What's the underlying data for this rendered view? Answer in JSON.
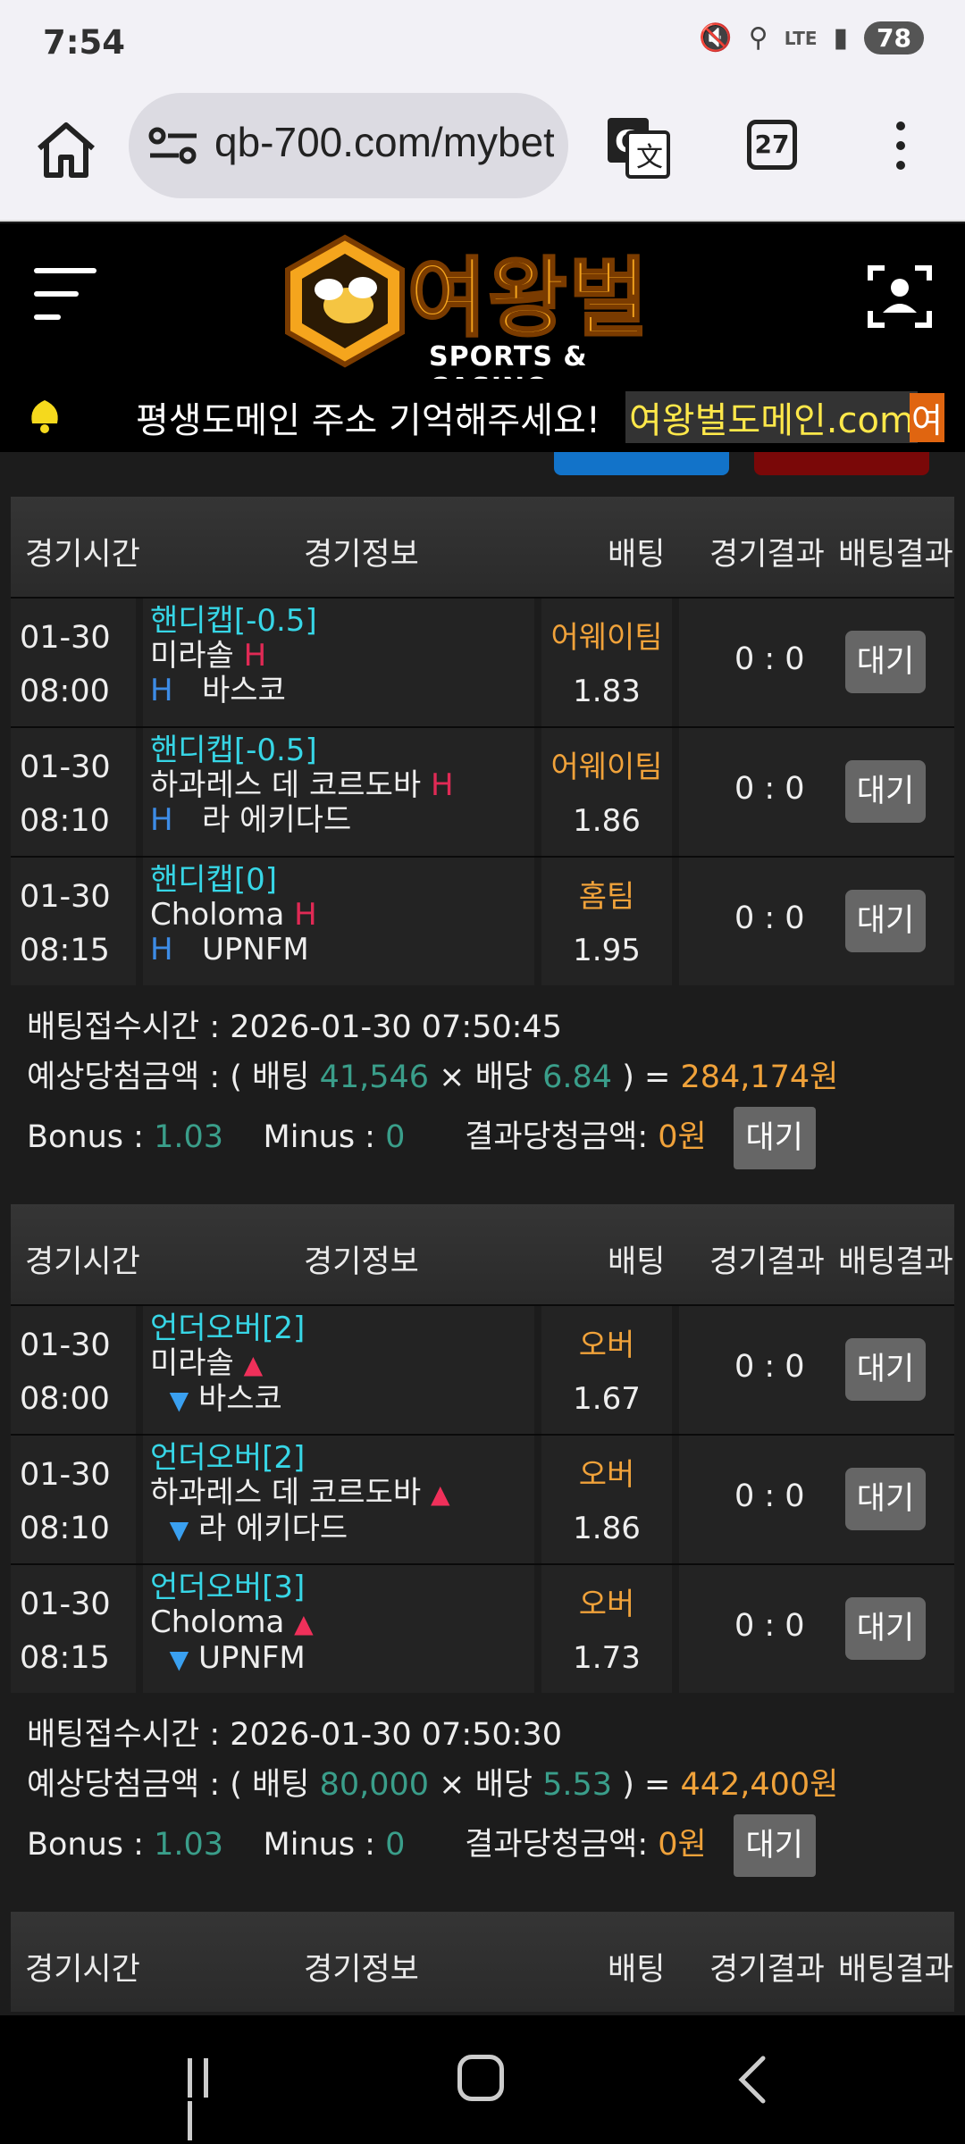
{
  "status_bar": {
    "time": "7:54",
    "network": "LTE",
    "battery": "78"
  },
  "browser": {
    "url": "qb-700.com/mybet",
    "tab_count": "27"
  },
  "site": {
    "logo_text": "여왕벌",
    "logo_sub": "SPORTS & CASINO"
  },
  "notice": {
    "text": "평생도메인 주소 기억해주세요!",
    "domain": "여왕벌도메인.com",
    "domain_tail": "여"
  },
  "table_headers": {
    "time": "경기시간",
    "info": "경기정보",
    "bet": "배팅",
    "result": "경기결과",
    "bet_result": "배팅결과"
  },
  "bets": [
    {
      "rows": [
        {
          "date": "01-30",
          "time": "08:00",
          "market": "핸디캡[-0.5]",
          "home": "미라솔",
          "home_mark": "H",
          "away_mark": "H",
          "away": "바스코",
          "pick": "어웨이팀",
          "odds": "1.83",
          "score": "0 : 0",
          "status": "대기"
        },
        {
          "date": "01-30",
          "time": "08:10",
          "market": "핸디캡[-0.5]",
          "home": "하과레스 데 코르도바",
          "home_mark": "H",
          "away_mark": "H",
          "away": "라 에키다드",
          "pick": "어웨이팀",
          "odds": "1.86",
          "score": "0 : 0",
          "status": "대기"
        },
        {
          "date": "01-30",
          "time": "08:15",
          "market": "핸디캡[0]",
          "home": "Choloma",
          "home_mark": "H",
          "away_mark": "H",
          "away": "UPNFM",
          "pick": "홈팀",
          "odds": "1.95",
          "score": "0 : 0",
          "status": "대기"
        }
      ],
      "summary": {
        "accept_label": "배팅접수시간 : ",
        "accept_time": "2026-01-30 07:50:45",
        "expected_label": "예상당첨금액 : ( 배팅 ",
        "stake": "41,546",
        "times": " × ",
        "odds_label": "배당 ",
        "total_odds": "6.84",
        "close": " ) = ",
        "expected": "284,174원",
        "bonus_label": "Bonus : ",
        "bonus": "1.03",
        "minus_label": "Minus : ",
        "minus": "0",
        "result_label": "결과당청금액: ",
        "result_amount": "0원",
        "status": "대기"
      }
    },
    {
      "rows": [
        {
          "date": "01-30",
          "time": "08:00",
          "market": "언더오버[2]",
          "home": "미라솔",
          "home_mark": "▲",
          "away_mark": "▼",
          "away": "바스코",
          "pick": "오버",
          "odds": "1.67",
          "score": "0 : 0",
          "status": "대기"
        },
        {
          "date": "01-30",
          "time": "08:10",
          "market": "언더오버[2]",
          "home": "하과레스 데 코르도바",
          "home_mark": "▲",
          "away_mark": "▼",
          "away": "라 에키다드",
          "pick": "오버",
          "odds": "1.86",
          "score": "0 : 0",
          "status": "대기"
        },
        {
          "date": "01-30",
          "time": "08:15",
          "market": "언더오버[3]",
          "home": "Choloma",
          "home_mark": "▲",
          "away_mark": "▼",
          "away": "UPNFM",
          "pick": "오버",
          "odds": "1.73",
          "score": "0 : 0",
          "status": "대기"
        }
      ],
      "summary": {
        "accept_label": "배팅접수시간 : ",
        "accept_time": "2026-01-30 07:50:30",
        "expected_label": "예상당첨금액 : ( 배팅 ",
        "stake": "80,000",
        "times": " × ",
        "odds_label": "배당 ",
        "total_odds": "5.53",
        "close": " ) = ",
        "expected": "442,400원",
        "bonus_label": "Bonus : ",
        "bonus": "1.03",
        "minus_label": "Minus : ",
        "minus": "0",
        "result_label": "결과당청금액: ",
        "result_amount": "0원",
        "status": "대기"
      }
    }
  ]
}
